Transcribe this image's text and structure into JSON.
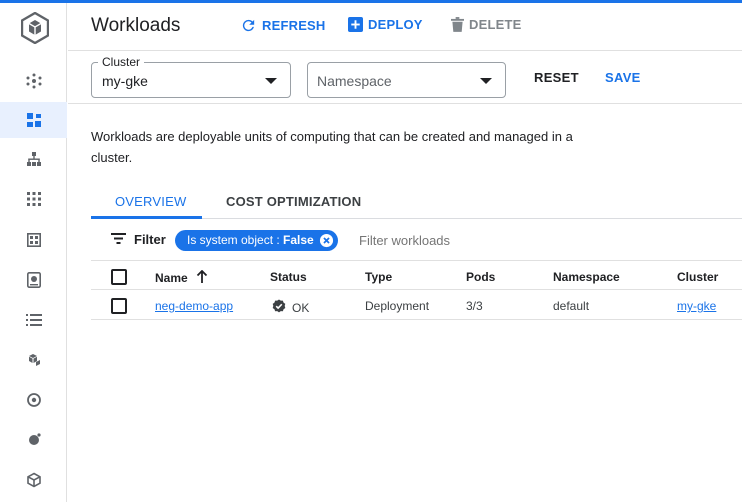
{
  "header": {
    "title": "Workloads",
    "refresh_label": "REFRESH",
    "deploy_label": "DEPLOY",
    "delete_label": "DELETE"
  },
  "filters": {
    "cluster_label": "Cluster",
    "cluster_value": "my-gke",
    "namespace_placeholder": "Namespace",
    "reset_label": "RESET",
    "save_label": "SAVE"
  },
  "description": "Workloads are deployable units of computing that can be created and managed in a cluster.",
  "tabs": [
    {
      "label": "OVERVIEW",
      "active": true
    },
    {
      "label": "COST OPTIMIZATION",
      "active": false
    }
  ],
  "filter_bar": {
    "filter_label": "Filter",
    "chip_key": "Is system object : ",
    "chip_value": "False",
    "placeholder": "Filter workloads"
  },
  "table": {
    "columns": [
      "Name",
      "Status",
      "Type",
      "Pods",
      "Namespace",
      "Cluster"
    ],
    "sort_column": "Name",
    "rows": [
      {
        "name": "neg-demo-app",
        "status": "OK",
        "type": "Deployment",
        "pods": "3/3",
        "namespace": "default",
        "cluster": "my-gke"
      }
    ]
  },
  "sidebar": {
    "items": [
      {
        "icon": "node-network-icon",
        "active": false
      },
      {
        "icon": "workloads-icon",
        "active": true
      },
      {
        "icon": "services-hierarchy-icon",
        "active": false
      },
      {
        "icon": "apps-grid-icon",
        "active": false
      },
      {
        "icon": "dashboard-grid-icon",
        "active": false
      },
      {
        "icon": "storage-disk-icon",
        "active": false
      },
      {
        "icon": "object-browser-icon",
        "active": false
      },
      {
        "icon": "marketplace-icon",
        "active": false
      },
      {
        "icon": "backup-icon",
        "active": false
      },
      {
        "icon": "feature-bug-icon",
        "active": false
      },
      {
        "icon": "release-notes-icon",
        "active": false
      }
    ]
  },
  "colors": {
    "accent": "#1a73e8",
    "active_nav_bg": "#e8f0fe"
  }
}
